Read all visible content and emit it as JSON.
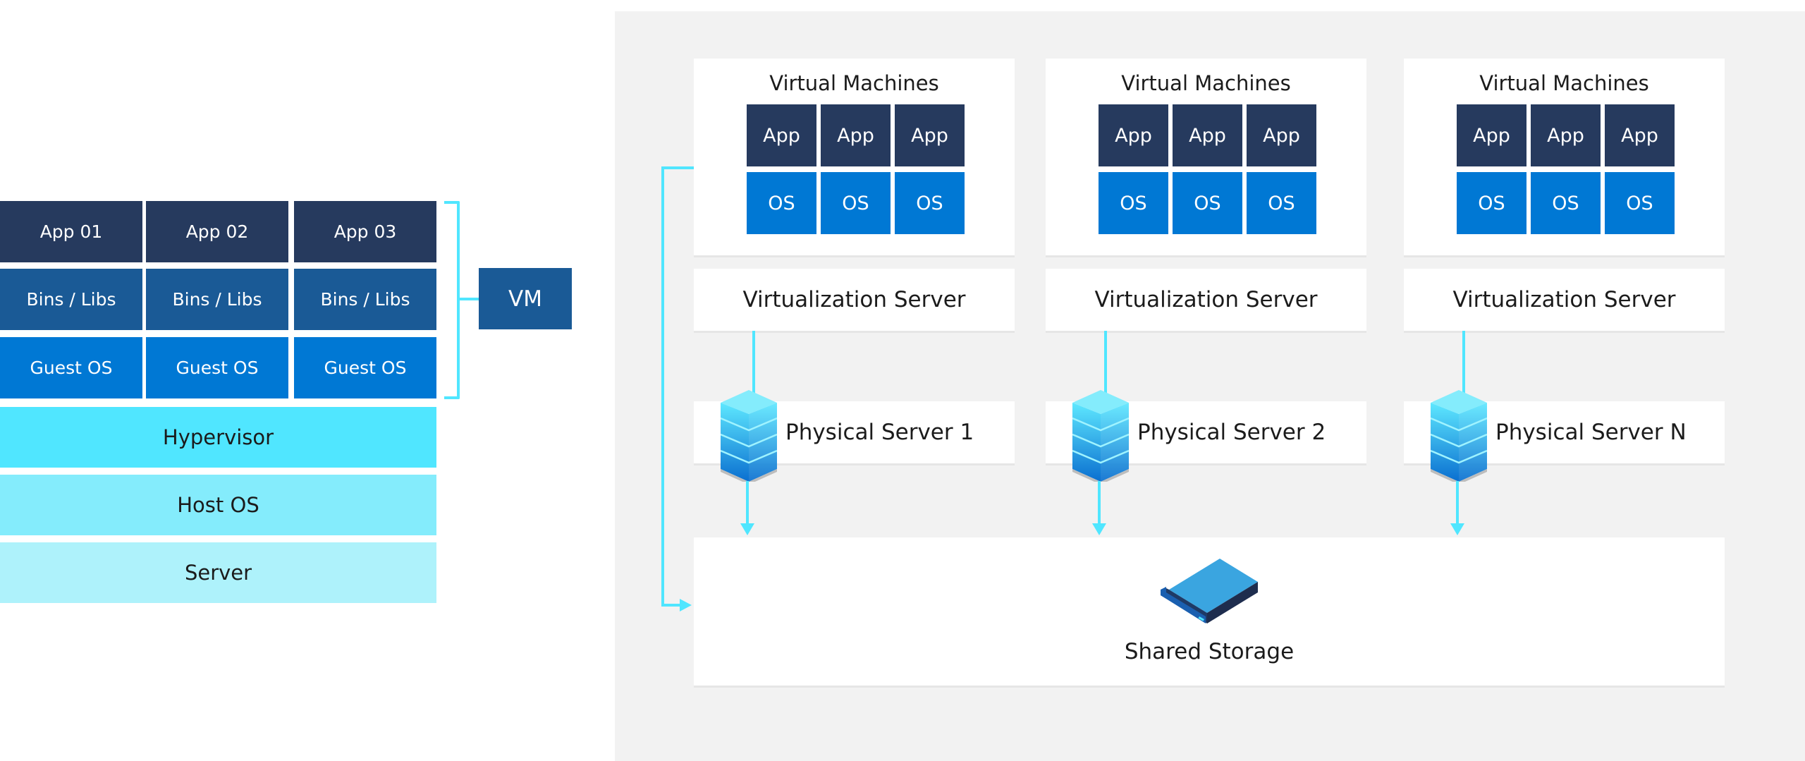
{
  "left_stack": {
    "columns": [
      {
        "app": "App 01",
        "bins": "Bins / Libs",
        "guest": "Guest OS"
      },
      {
        "app": "App 02",
        "bins": "Bins / Libs",
        "guest": "Guest OS"
      },
      {
        "app": "App 03",
        "bins": "Bins / Libs",
        "guest": "Guest OS"
      }
    ],
    "hypervisor": "Hypervisor",
    "host_os": "Host OS",
    "server": "Server",
    "vm_label": "VM"
  },
  "cluster": {
    "nodes": [
      {
        "vm_title": "Virtual Machines",
        "apps": [
          "App",
          "App",
          "App"
        ],
        "oses": [
          "OS",
          "OS",
          "OS"
        ],
        "virt_server": "Virtualization Server",
        "physical_server": "Physical Server 1"
      },
      {
        "vm_title": "Virtual Machines",
        "apps": [
          "App",
          "App",
          "App"
        ],
        "oses": [
          "OS",
          "OS",
          "OS"
        ],
        "virt_server": "Virtualization Server",
        "physical_server": "Physical Server 2"
      },
      {
        "vm_title": "Virtual Machines",
        "apps": [
          "App",
          "App",
          "App"
        ],
        "oses": [
          "OS",
          "OS",
          "OS"
        ],
        "virt_server": "Virtualization Server",
        "physical_server": "Physical Server N"
      }
    ],
    "shared_storage": "Shared Storage"
  },
  "colors": {
    "app": "#263a5e",
    "bins": "#1a5a96",
    "guest_os": "#0078d4",
    "hypervisor": "#50e6ff",
    "host_os": "#84ecfc",
    "server": "#aef2fb",
    "connector": "#50e6ff",
    "panel": "#f2f2f2"
  }
}
